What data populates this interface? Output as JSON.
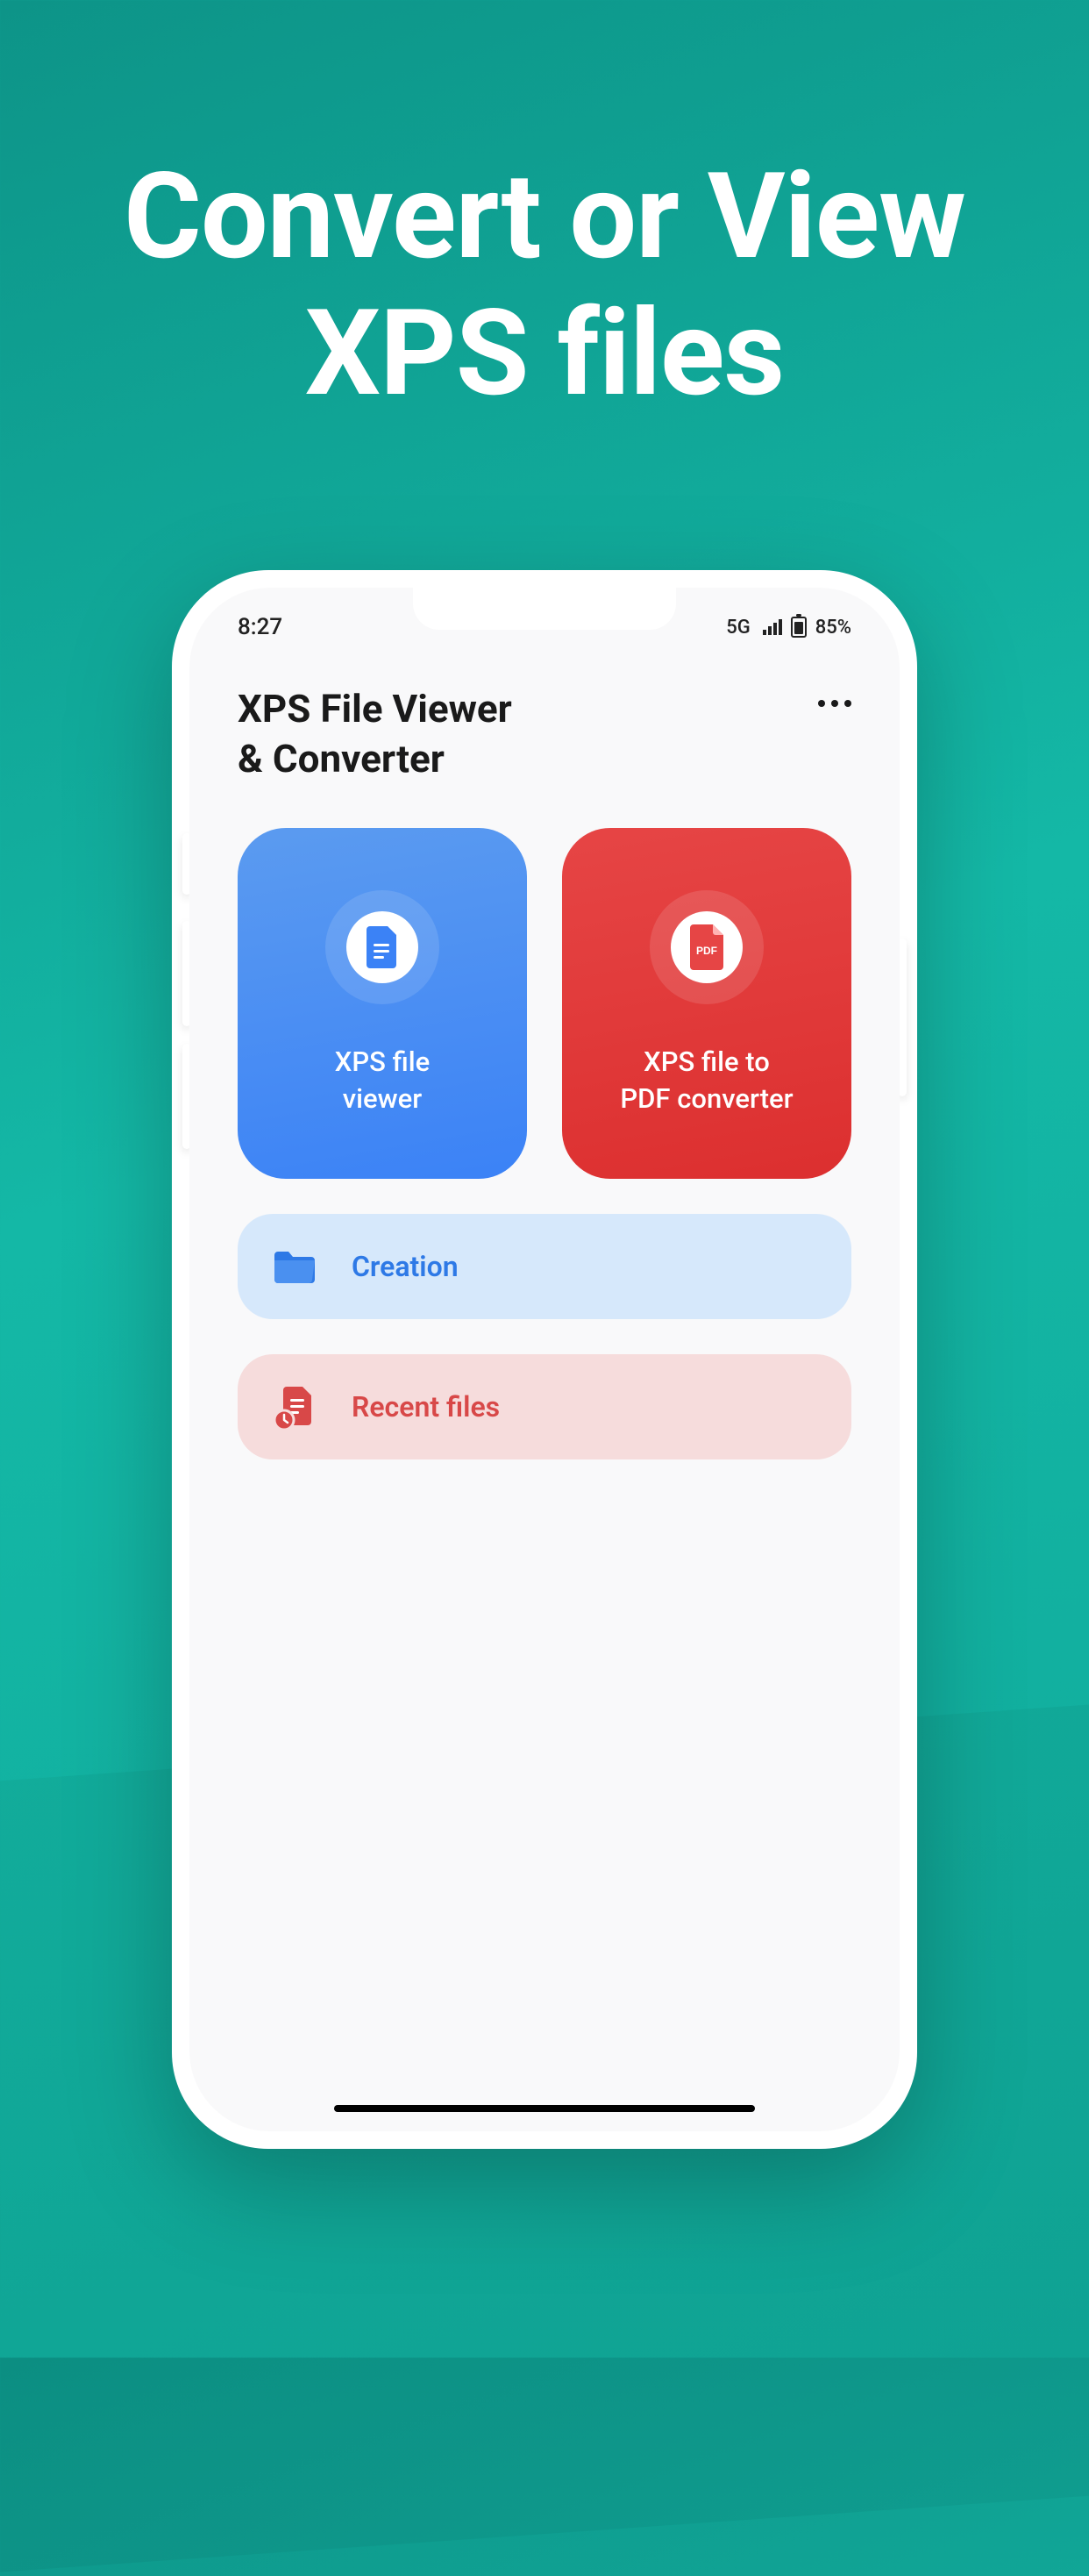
{
  "hero": {
    "line1": "Convert or View",
    "line2": "XPS files"
  },
  "statusbar": {
    "time": "8:27",
    "network": "5G",
    "battery_pct": "85%"
  },
  "app": {
    "title_line1": "XPS File Viewer",
    "title_line2": "& Converter"
  },
  "cards": {
    "viewer": {
      "line1": "XPS file",
      "line2": "viewer"
    },
    "converter": {
      "line1": "XPS file to",
      "line2": "PDF converter",
      "icon_badge": "PDF"
    }
  },
  "list": {
    "creation": "Creation",
    "recent": "Recent files"
  },
  "colors": {
    "bg_teal": "#14b8a6",
    "card_blue": "#3b82f6",
    "card_red": "#dc2f2f",
    "soft_blue": "#d6e8fb",
    "soft_red": "#f6dcdc"
  }
}
